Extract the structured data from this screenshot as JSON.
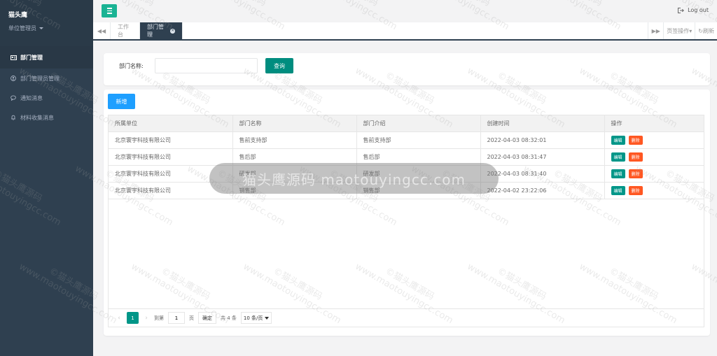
{
  "app": {
    "name": "猫头鹰",
    "role": "单位管理员"
  },
  "sidebar": {
    "items": [
      {
        "label": "部门管理",
        "icon": "id-card-icon",
        "active": true
      },
      {
        "label": "部门管理员管理",
        "icon": "user-icon",
        "active": false
      },
      {
        "label": "通知消息",
        "icon": "chat-icon",
        "active": false
      },
      {
        "label": "材料收集消息",
        "icon": "bell-icon",
        "active": false
      }
    ]
  },
  "topbar": {
    "logout_label": "Log out"
  },
  "tabs": {
    "items": [
      {
        "label": "工作台",
        "active": false
      },
      {
        "label": "部门管理",
        "active": true
      }
    ],
    "page_ops_label": "页签操作",
    "refresh_label": "刷新"
  },
  "search": {
    "label": "部门名称:",
    "value": "",
    "placeholder": "",
    "query_label": "查询"
  },
  "table": {
    "add_label": "新增",
    "columns": [
      "所属单位",
      "部门名称",
      "部门介绍",
      "创建时间",
      "操作"
    ],
    "rows": [
      {
        "unit": "北京寰宇科技有限公司",
        "name": "售前支持部",
        "intro": "售前支持部",
        "created": "2022-04-03 08:32:01"
      },
      {
        "unit": "北京寰宇科技有限公司",
        "name": "售后部",
        "intro": "售后部",
        "created": "2022-04-03 08:31:47"
      },
      {
        "unit": "北京寰宇科技有限公司",
        "name": "研发部",
        "intro": "研发部",
        "created": "2022-04-03 08:31:40"
      },
      {
        "unit": "北京寰宇科技有限公司",
        "name": "销售部",
        "intro": "销售部",
        "created": "2022-04-02 23:22:06"
      }
    ],
    "edit_label": "编辑",
    "delete_label": "删除"
  },
  "pager": {
    "current": "1",
    "goto_prefix": "到第",
    "goto_value": "1",
    "page_suffix": "页",
    "confirm_label": "确定",
    "total_label": "共 4 条",
    "page_size_label": "10 条/页"
  },
  "watermark": {
    "line1": "©猫头鹰源码",
    "line2": "www.maotouyingcc.com",
    "center": "猫头鹰源码 maotouyingcc.com"
  },
  "colors": {
    "sidebar": "#2f4050",
    "primary": "#009688",
    "accent_blue": "#1e9fff",
    "danger": "#ff5722"
  }
}
